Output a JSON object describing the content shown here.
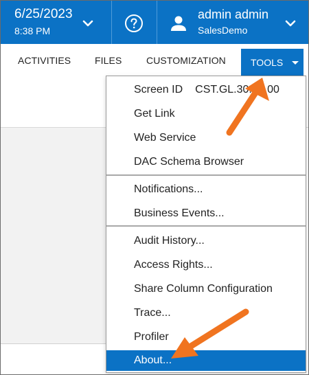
{
  "header": {
    "date": "6/25/2023",
    "time": "8:38 PM",
    "user_name": "admin admin",
    "company": "SalesDemo"
  },
  "tabs": {
    "activities": "ACTIVITIES",
    "files": "FILES",
    "customization": "CUSTOMIZATION",
    "tools": "TOOLS"
  },
  "menu": {
    "screen_id_label": "Screen ID",
    "screen_id_value": "CST.GL.30.00.00",
    "get_link": "Get Link",
    "web_service": "Web Service",
    "dac_schema_browser": "DAC Schema Browser",
    "notifications": "Notifications...",
    "business_events": "Business Events...",
    "audit_history": "Audit History...",
    "access_rights": "Access Rights...",
    "share_column_configuration": "Share Column Configuration",
    "trace": "Trace...",
    "profiler": "Profiler",
    "about": "About..."
  },
  "colors": {
    "brand_blue": "#0b72c5",
    "arrow_orange": "#f07420"
  },
  "icons": {
    "date_chevron": "chevron-down-icon",
    "help": "help-circle-icon",
    "user": "user-icon",
    "user_chevron": "chevron-down-icon",
    "tools_caret": "caret-down-icon"
  }
}
